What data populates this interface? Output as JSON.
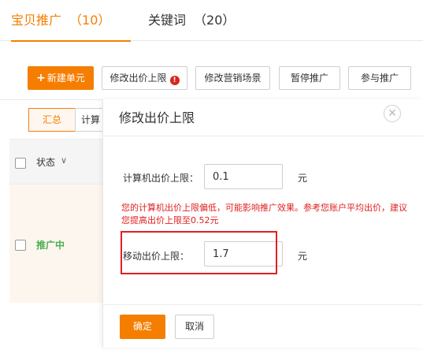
{
  "tabs": [
    {
      "label": "宝贝推广",
      "count": "（10）"
    },
    {
      "label": "关键词",
      "count": "（20）"
    }
  ],
  "toolbar": {
    "new_unit": "新建单元",
    "modify_bid_cap": "修改出价上限",
    "modify_scene": "修改营销场景",
    "pause": "暂停推广",
    "resume": "参与推广"
  },
  "view_toggle": {
    "summary": "汇总",
    "compute": "计算"
  },
  "table": {
    "status_header": "状态",
    "rows": [
      {
        "status": "推广中"
      }
    ]
  },
  "dialog": {
    "title": "修改出价上限",
    "pc_label": "计算机出价上限：",
    "pc_value": "0.1",
    "mobile_label": "移动出价上限：",
    "mobile_value": "1.7",
    "unit": "元",
    "warning": "您的计算机出价上限偏低，可能影响推广效果。参考您账户平均出价，建议您提高出价上限至0.52元",
    "confirm": "确定",
    "cancel": "取消"
  },
  "colors": {
    "accent": "#f57e00",
    "warning": "#e02020",
    "active_status": "#4caf50"
  }
}
